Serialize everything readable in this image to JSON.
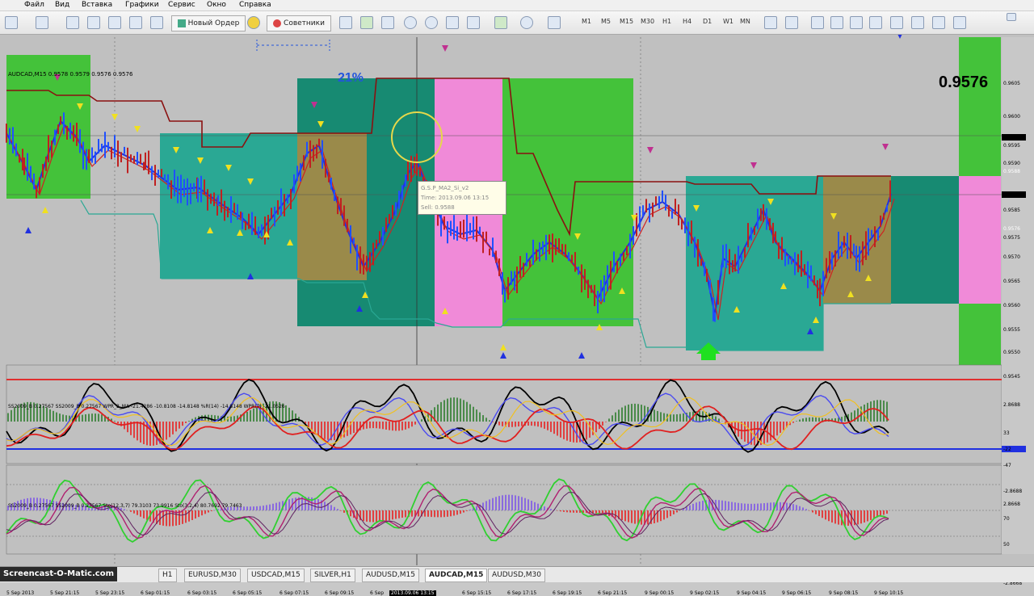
{
  "menu": [
    "Файл",
    "Вид",
    "Вставка",
    "Графики",
    "Сервис",
    "Окно",
    "Справка"
  ],
  "toolbar": {
    "new_order": "Новый Ордер",
    "advisors": "Советники",
    "timeframes": [
      "M1",
      "M5",
      "M15",
      "M30",
      "H1",
      "H4",
      "D1",
      "W1",
      "MN"
    ]
  },
  "chart": {
    "symbol_title": "AUDCAD,M15  0.9578 0.9579 0.9576 0.9576",
    "price_big": "0.9576",
    "percent": "21%",
    "tooltip": [
      "G.S.P_MA2_Si_v2",
      "Time: 2013.09.06 13:15",
      "Sell: 0.9588"
    ],
    "price_axis": [
      "0.9605",
      "0.9600",
      "0.9595",
      "0.9590",
      "0.9588",
      "0.9585",
      "0.9576",
      "0.9575",
      "0.9570",
      "0.9565",
      "0.9560",
      "0.9555",
      "0.9550",
      "0.9545"
    ],
    "price_current": "0.9576",
    "price_marker": "0.9588"
  },
  "indicator1": {
    "title": "SS2009_B 0.27567  SS2009_B 0.27567  WPR_3_MA -21.4286 -10.8108 -14.8148  %R(14) -14.8148  WPR(7) -21.0526",
    "axis": [
      "2.8688",
      "33",
      "-22",
      "-47",
      "-2.8688"
    ]
  },
  "indicator2": {
    "title": "SS2009_B 0.27567  SS2009_B 0.27567  Sto(12,3,7) 79.3103 73.9916  Sto(3,2,4) 80.7692 79.7463",
    "axis": [
      "2.8668",
      "70",
      "50",
      "30",
      "-2.8668"
    ]
  },
  "time_axis": [
    "5 Sep 2013",
    "5 Sep 21:15",
    "5 Sep 23:15",
    "6 Sep 01:15",
    "6 Sep 03:15",
    "6 Sep 05:15",
    "6 Sep 07:15",
    "6 Sep 09:15",
    "6 Sep",
    "2013.09.06 13:15",
    "6 Sep 15:15",
    "6 Sep 17:15",
    "6 Sep 19:15",
    "6 Sep 21:15",
    "9 Sep 00:15",
    "9 Sep 02:15",
    "9 Sep 04:15",
    "9 Sep 06:15",
    "9 Sep 08:15",
    "9 Sep 10:15"
  ],
  "tabs": [
    "H1",
    "EURUSD,M30",
    "USDCAD,M15",
    "SILVER,H1",
    "AUDUSD,M15",
    "AUDCAD,M15",
    "AUDUSD,M30"
  ],
  "active_tab": "AUDCAD,M15",
  "watermark": "Screencast-O-Matic.com",
  "colors": {
    "zone_green": "#44c23a",
    "zone_teal": "#2aa894",
    "zone_darkteal": "#178a72",
    "zone_olive": "#9a8a4a",
    "zone_pink": "#f08ad8",
    "line_blue": "#2030e0",
    "line_red": "#d02020",
    "line_darkred": "#8a1010"
  }
}
